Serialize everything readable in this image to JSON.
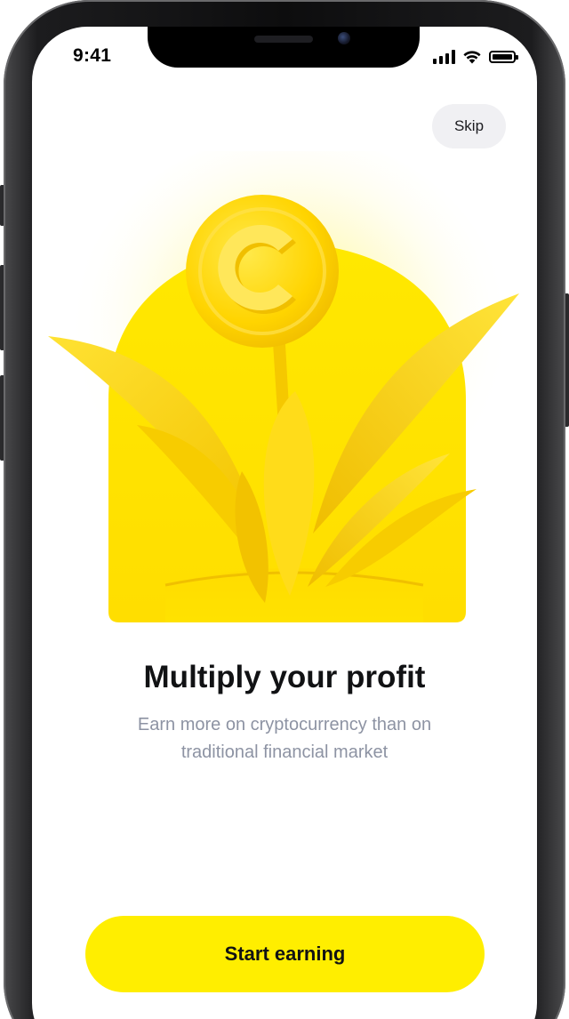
{
  "status_bar": {
    "time": "9:41",
    "icons": [
      "cellular-signal-icon",
      "wifi-icon",
      "battery-icon"
    ]
  },
  "onboarding": {
    "skip_label": "Skip",
    "illustration": "coin-plant-illustration",
    "title": "Multiply your profit",
    "subtitle": "Earn more on cryptocurrency than on traditional financial market",
    "cta_label": "Start earning"
  },
  "colors": {
    "accent": "#ffee00",
    "illustration_yellow": "#ffe500",
    "title_text": "#111214",
    "subtitle_text": "#8d93a3",
    "skip_background": "#f0f0f3"
  }
}
